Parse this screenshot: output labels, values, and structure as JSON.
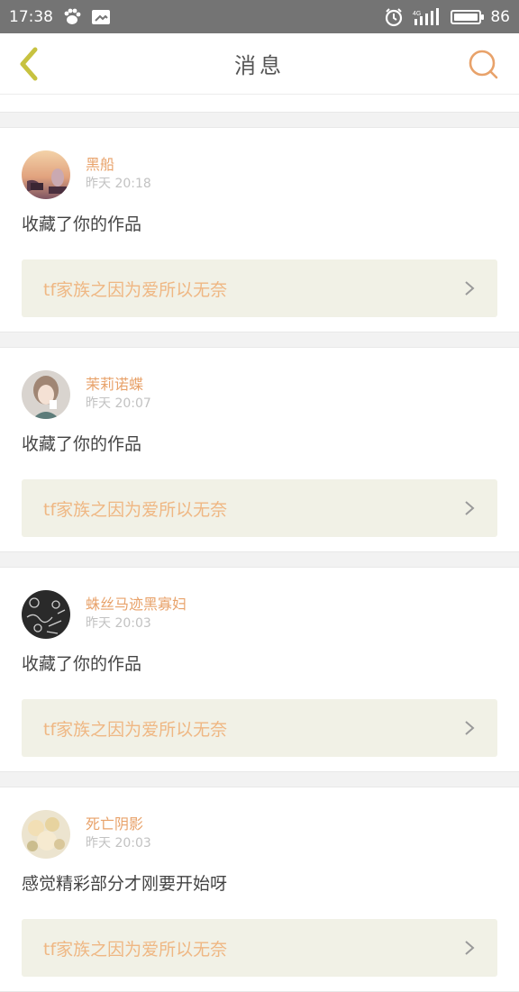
{
  "statusbar": {
    "time": "17:38",
    "network": "4G",
    "battery": "86",
    "icons": [
      "baidu-paw-icon",
      "image-icon",
      "alarm-icon",
      "signal-icon",
      "battery-icon"
    ]
  },
  "header": {
    "title": "消息",
    "back_icon": "chevron-left-icon",
    "search_icon": "search-icon",
    "accent": "#e8a26a",
    "back_color": "#c7c240"
  },
  "messages": [
    {
      "username": "黑船",
      "time": "昨天  20:18",
      "action": "收藏了你的作品",
      "work_title": "tf家族之因为爱所以无奈"
    },
    {
      "username": "茉莉诺蝶",
      "time": "昨天  20:07",
      "action": "收藏了你的作品",
      "work_title": "tf家族之因为爱所以无奈"
    },
    {
      "username": "蛛丝马迹黑寡妇",
      "time": "昨天  20:03",
      "action": "收藏了你的作品",
      "work_title": "tf家族之因为爱所以无奈"
    },
    {
      "username": "死亡阴影",
      "time": "昨天  20:03",
      "action": "感觉精彩部分才刚要开始呀",
      "work_title": "tf家族之因为爱所以无奈"
    }
  ]
}
